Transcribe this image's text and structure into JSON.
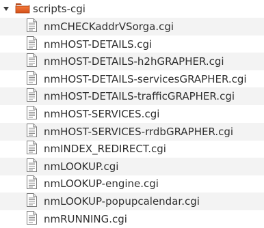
{
  "folder": {
    "name": "scripts-cgi",
    "expanded": true,
    "icon": "folder-icon",
    "color": "#e8641c"
  },
  "files": [
    {
      "name": "nmCHECKaddrVSorga.cgi",
      "icon": "text-file-icon"
    },
    {
      "name": "nmHOST-DETAILS.cgi",
      "icon": "text-file-icon"
    },
    {
      "name": "nmHOST-DETAILS-h2hGRAPHER.cgi",
      "icon": "text-file-icon"
    },
    {
      "name": "nmHOST-DETAILS-servicesGRAPHER.cgi",
      "icon": "text-file-icon"
    },
    {
      "name": "nmHOST-DETAILS-trafficGRAPHER.cgi",
      "icon": "text-file-icon"
    },
    {
      "name": "nmHOST-SERVICES.cgi",
      "icon": "text-file-icon"
    },
    {
      "name": "nmHOST-SERVICES-rrdbGRAPHER.cgi",
      "icon": "text-file-icon"
    },
    {
      "name": "nmINDEX_REDIRECT.cgi",
      "icon": "text-file-icon"
    },
    {
      "name": "nmLOOKUP.cgi",
      "icon": "text-file-icon"
    },
    {
      "name": "nmLOOKUP-engine.cgi",
      "icon": "text-file-icon"
    },
    {
      "name": "nmLOOKUP-popupcalendar.cgi",
      "icon": "text-file-icon"
    },
    {
      "name": "nmRUNNING.cgi",
      "icon": "text-file-icon"
    }
  ]
}
